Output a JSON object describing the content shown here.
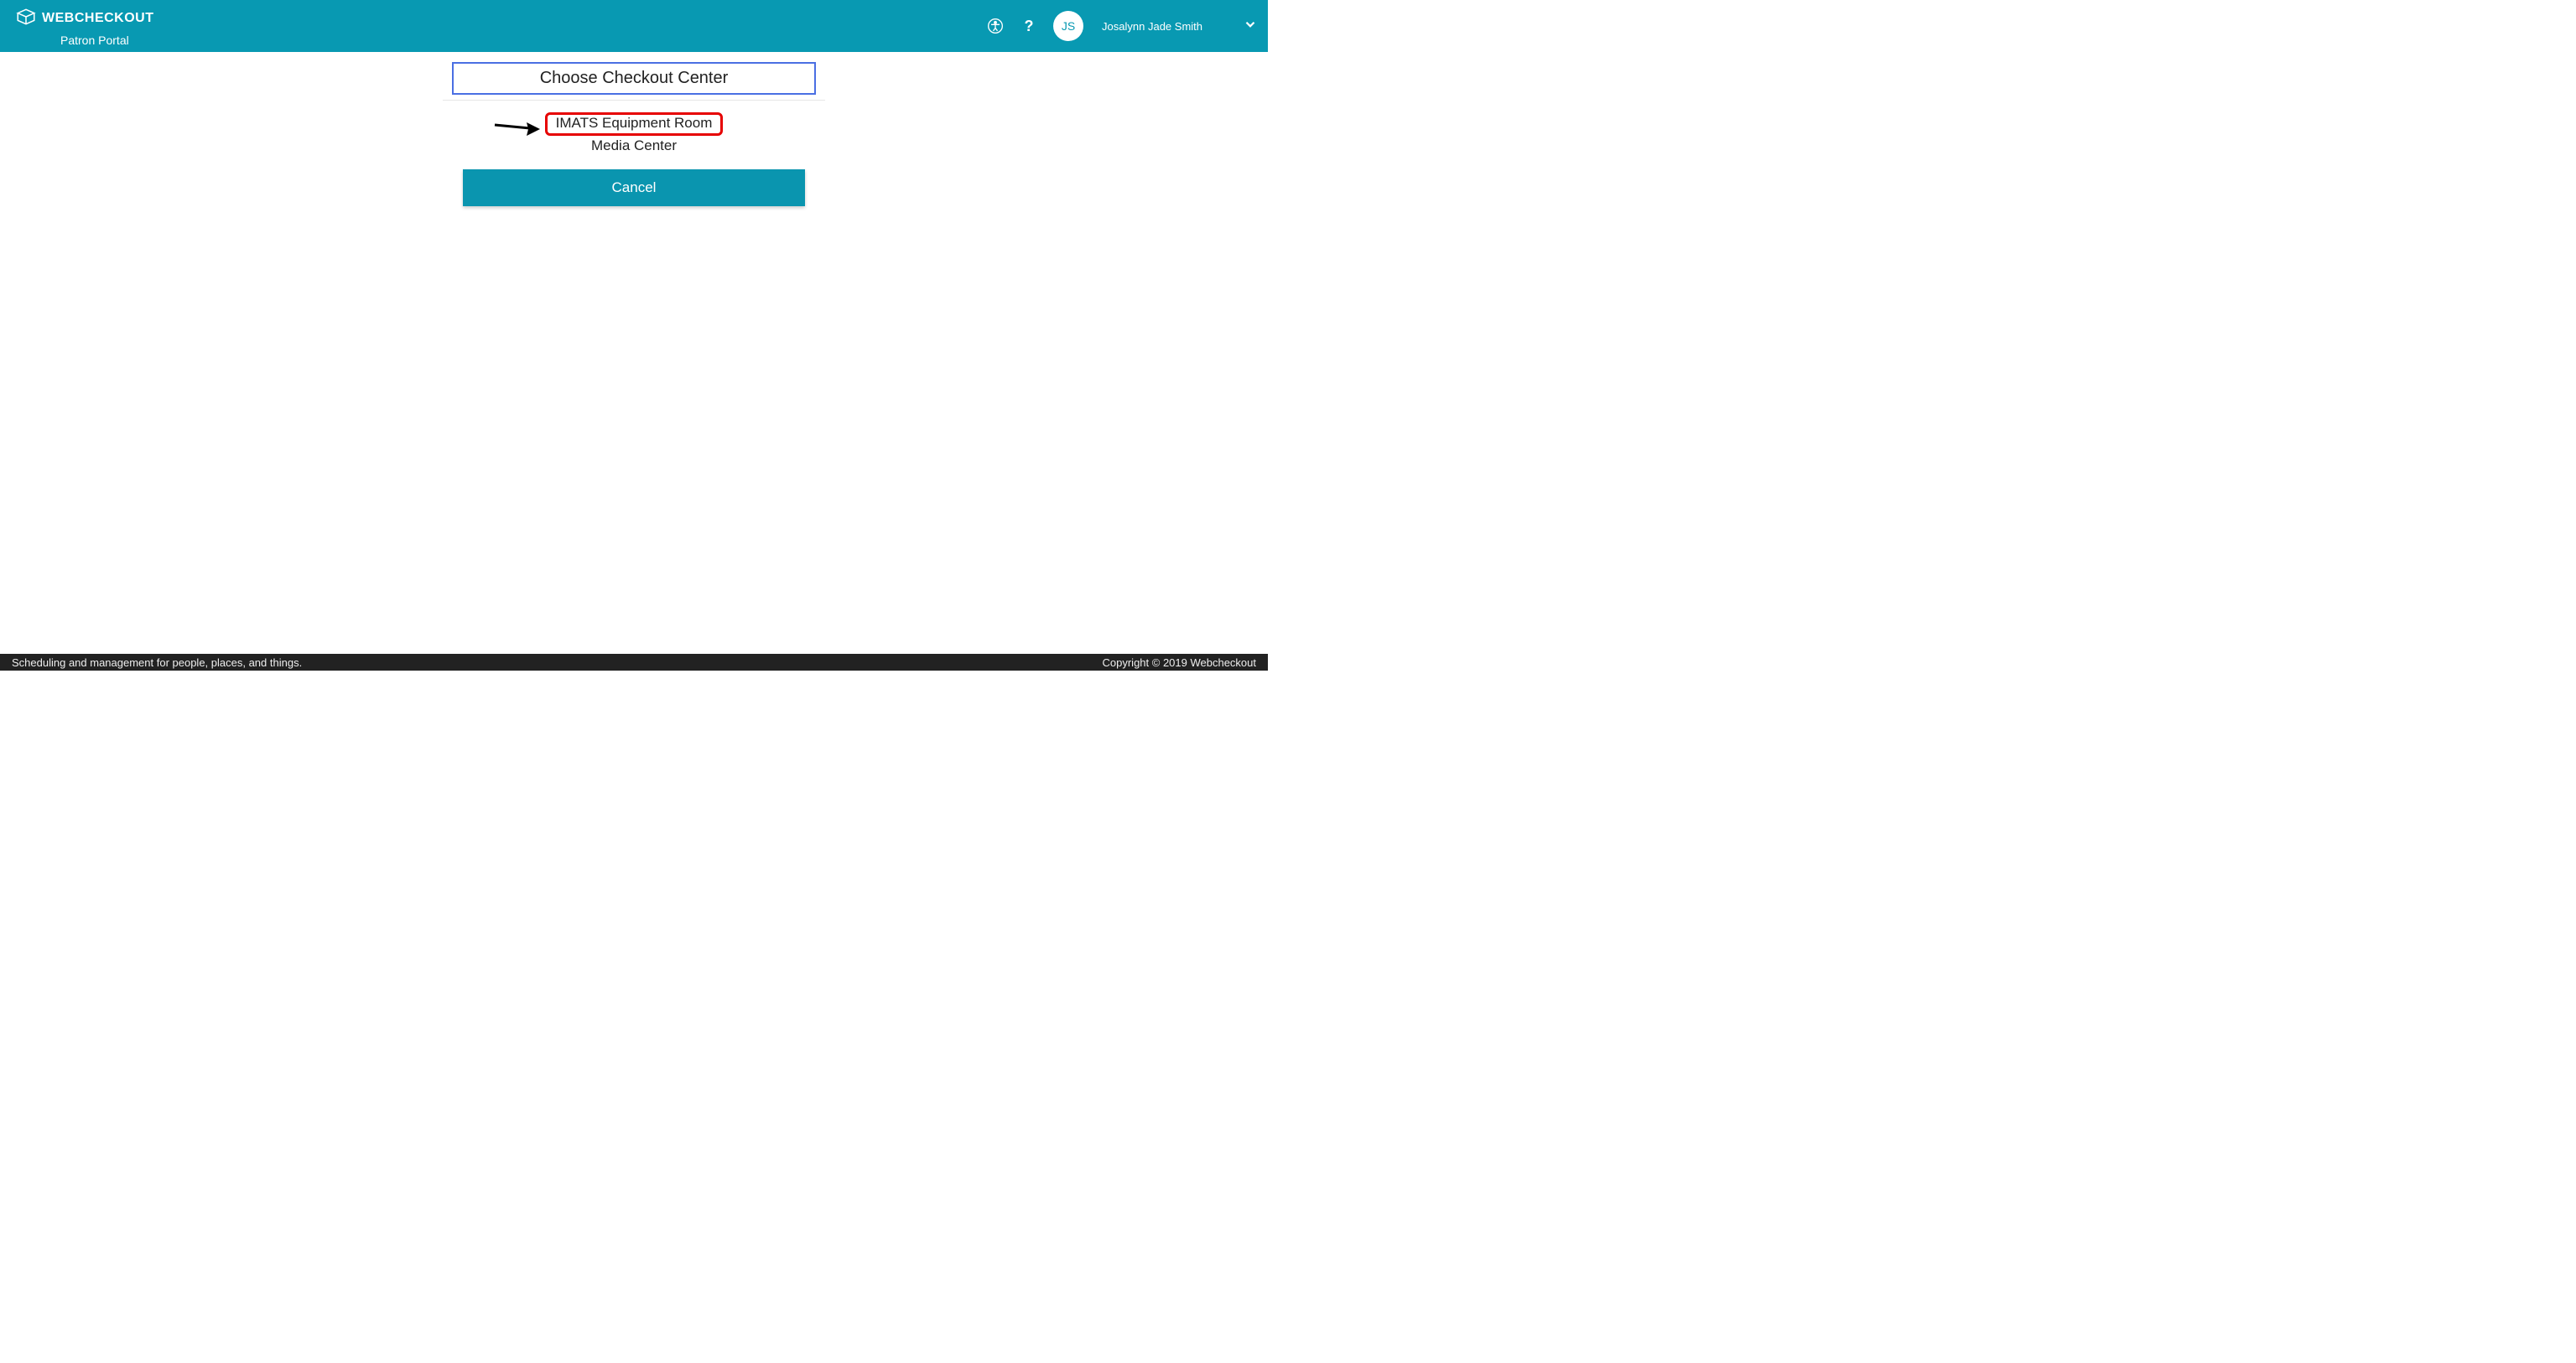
{
  "header": {
    "brand_name": "WEBCHECKOUT",
    "brand_sub": "Patron Portal",
    "user_initials": "JS",
    "user_name": "Josalynn Jade Smith"
  },
  "main": {
    "title": "Choose Checkout Center",
    "options": {
      "highlighted": "IMATS Equipment Room",
      "plain": "Media Center"
    },
    "cancel_label": "Cancel"
  },
  "footer": {
    "left": "Scheduling and management for people, places, and things.",
    "right": "Copyright © 2019 Webcheckout"
  }
}
